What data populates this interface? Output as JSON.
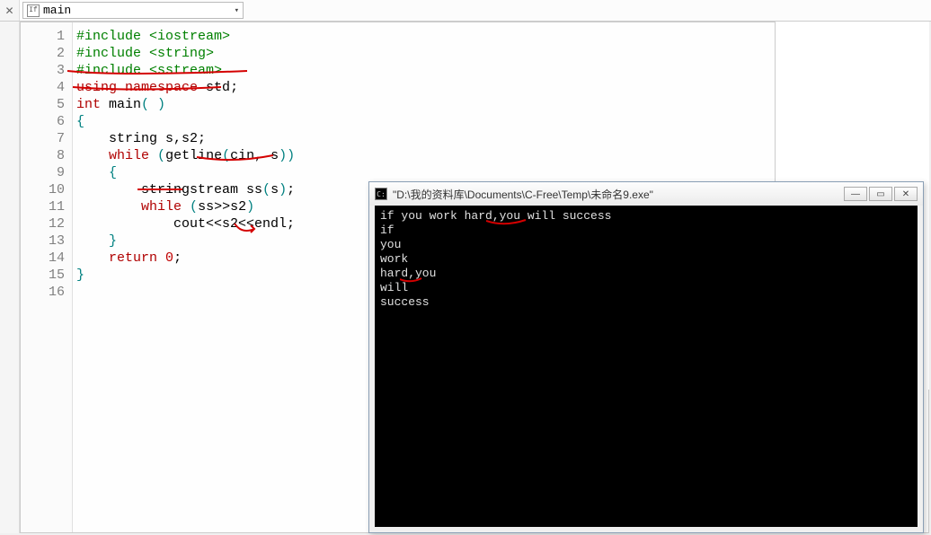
{
  "tab": {
    "close_glyph": "✕"
  },
  "dropdown": {
    "icon_text": "If",
    "label": "main",
    "chev": "▾"
  },
  "gutter": [
    "1",
    "2",
    "3",
    "4",
    "5",
    "6",
    "7",
    "8",
    "9",
    "10",
    "11",
    "12",
    "13",
    "14",
    "15",
    "16"
  ],
  "code": {
    "l1": {
      "a": "#include ",
      "b": "<iostream>"
    },
    "l2": {
      "a": "#include ",
      "b": "<string>"
    },
    "l3": {
      "a": "#include ",
      "b": "<sstream>"
    },
    "l4": {
      "a": "using",
      "b": " ",
      "c": "namespace",
      "d": " std",
      "e": ";"
    },
    "l5": {
      "a": "int",
      "b": " main",
      "c": "( )"
    },
    "l6": {
      "a": "{"
    },
    "l7": {
      "a": "    string s,s2;"
    },
    "l8": {
      "a": "    ",
      "b": "while",
      "c": " ",
      "d": "(",
      "e": "getline",
      "f": "(",
      "g": "cin",
      "h": ", s",
      "i": ")",
      "j": ")"
    },
    "l9": {
      "a": "    ",
      "b": "{"
    },
    "l10": {
      "a": "        stringstream ss",
      "b": "(",
      "c": "s",
      "d": ")",
      "e": ";"
    },
    "l11": {
      "a": "        ",
      "b": "while",
      "c": " ",
      "d": "(",
      "e": "ss>>s2",
      "f": ")"
    },
    "l12": {
      "a": "            cout<<s2<<endl;"
    },
    "l13": {
      "a": "    ",
      "b": "}"
    },
    "l14": {
      "a": "    ",
      "b": "return",
      "c": " ",
      "d": "0",
      "e": ";"
    },
    "l15": {
      "a": "}"
    }
  },
  "console": {
    "title": "\"D:\\我的资料库\\Documents\\C-Free\\Temp\\未命名9.exe\"",
    "lines": [
      "if you work hard,you will success",
      "if",
      "you",
      "work",
      "hard,you",
      "will",
      "success"
    ],
    "win_btns": {
      "min": "—",
      "max": "▭",
      "close": "✕"
    }
  },
  "side_drag": "⋮⋮"
}
